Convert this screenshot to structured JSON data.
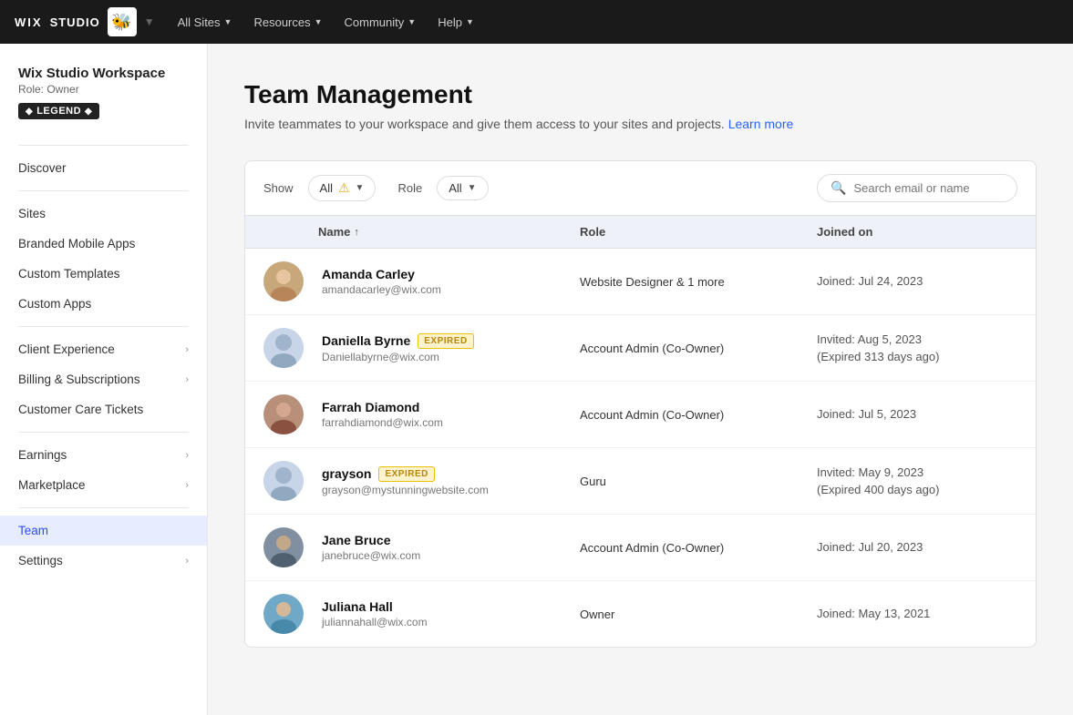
{
  "topnav": {
    "logo_wix": "WIX",
    "logo_studio": "STUDIO",
    "items": [
      {
        "label": "All Sites",
        "has_chevron": true
      },
      {
        "label": "Resources",
        "has_chevron": true
      },
      {
        "label": "Community",
        "has_chevron": true
      },
      {
        "label": "Help",
        "has_chevron": true
      }
    ]
  },
  "sidebar": {
    "workspace_name": "Wix Studio Workspace",
    "workspace_role": "Role: Owner",
    "badge_label": "LEGEND",
    "nav_items": [
      {
        "id": "discover",
        "label": "Discover",
        "has_chevron": false,
        "active": false
      },
      {
        "id": "sites",
        "label": "Sites",
        "has_chevron": false,
        "active": false
      },
      {
        "id": "branded-mobile-apps",
        "label": "Branded Mobile Apps",
        "has_chevron": false,
        "active": false
      },
      {
        "id": "custom-templates",
        "label": "Custom Templates",
        "has_chevron": false,
        "active": false
      },
      {
        "id": "custom-apps",
        "label": "Custom Apps",
        "has_chevron": false,
        "active": false
      },
      {
        "id": "client-experience",
        "label": "Client Experience",
        "has_chevron": true,
        "active": false
      },
      {
        "id": "billing-subscriptions",
        "label": "Billing & Subscriptions",
        "has_chevron": true,
        "active": false
      },
      {
        "id": "customer-care-tickets",
        "label": "Customer Care Tickets",
        "has_chevron": false,
        "active": false
      },
      {
        "id": "earnings",
        "label": "Earnings",
        "has_chevron": true,
        "active": false
      },
      {
        "id": "marketplace",
        "label": "Marketplace",
        "has_chevron": true,
        "active": false
      },
      {
        "id": "team",
        "label": "Team",
        "has_chevron": false,
        "active": true
      },
      {
        "id": "settings",
        "label": "Settings",
        "has_chevron": true,
        "active": false
      }
    ]
  },
  "page": {
    "title": "Team Management",
    "subtitle": "Invite teammates to your workspace and give them access to your sites and projects.",
    "learn_more": "Learn more"
  },
  "filters": {
    "show_label": "Show",
    "show_value": "All",
    "role_label": "Role",
    "role_value": "All",
    "search_placeholder": "Search email or name"
  },
  "table": {
    "headers": {
      "name": "Name",
      "sort_indicator": "↑",
      "role": "Role",
      "joined": "Joined on"
    },
    "members": [
      {
        "id": "amanda",
        "name": "Amanda Carley",
        "email": "amandacarley@wix.com",
        "role": "Website Designer & 1 more",
        "joined": "Joined: Jul 24, 2023",
        "expired": false,
        "avatar_type": "photo"
      },
      {
        "id": "daniella",
        "name": "Daniella Byrne",
        "email": "Daniellabyrne@wix.com",
        "role": "Account Admin (Co-Owner)",
        "joined": "Invited: Aug 5, 2023\n(Expired 313 days ago)",
        "expired": true,
        "avatar_type": "placeholder"
      },
      {
        "id": "farrah",
        "name": "Farrah Diamond",
        "email": "farrahdiamond@wix.com",
        "role": "Account Admin (Co-Owner)",
        "joined": "Joined: Jul 5, 2023",
        "expired": false,
        "avatar_type": "photo"
      },
      {
        "id": "grayson",
        "name": "grayson",
        "email": "grayson@mystunningwebsite.com",
        "role": "Guru",
        "joined": "Invited: May 9, 2023\n(Expired 400 days ago)",
        "expired": true,
        "avatar_type": "placeholder"
      },
      {
        "id": "jane",
        "name": "Jane Bruce",
        "email": "janebruce@wix.com",
        "role": "Account Admin (Co-Owner)",
        "joined": "Joined: Jul 20, 2023",
        "expired": false,
        "avatar_type": "photo"
      },
      {
        "id": "juliana",
        "name": "Juliana Hall",
        "email": "juliannahall@wix.com",
        "role": "Owner",
        "joined": "Joined: May 13, 2021",
        "expired": false,
        "avatar_type": "photo"
      }
    ],
    "expired_label": "EXPIRED"
  },
  "colors": {
    "active_bg": "#e8ecff",
    "active_text": "#2f4bff",
    "link_color": "#2962ff",
    "expired_bg": "#fff3cd",
    "header_bg": "#eef1f8"
  }
}
